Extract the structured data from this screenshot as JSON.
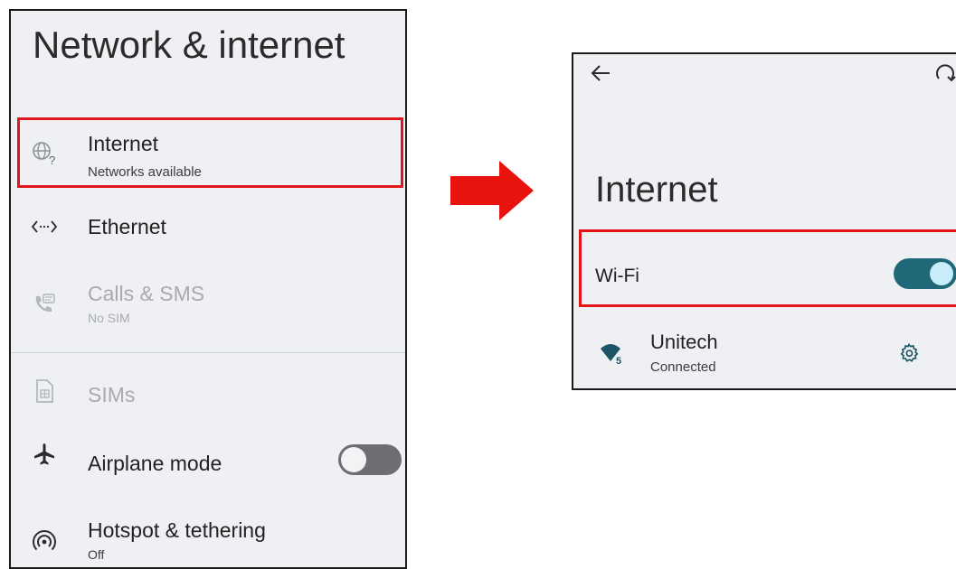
{
  "left": {
    "title": "Network & internet",
    "items": [
      {
        "label": "Internet",
        "sub": "Networks available",
        "icon": "globe-question-icon"
      },
      {
        "label": "Ethernet",
        "icon": "ethernet-icon"
      },
      {
        "label": "Calls & SMS",
        "sub": "No SIM",
        "icon": "calls-sms-icon"
      },
      {
        "label": "SIMs",
        "icon": "sim-card-icon"
      },
      {
        "label": "Airplane mode",
        "icon": "airplane-icon",
        "toggle": "off"
      },
      {
        "label": "Hotspot & tethering",
        "sub": "Off",
        "icon": "hotspot-icon"
      }
    ]
  },
  "right": {
    "title": "Internet",
    "wifi_label": "Wi-Fi",
    "wifi_toggle": "on",
    "network": {
      "name": "Unitech",
      "status": "Connected"
    }
  },
  "colors": {
    "highlight": "#e0161b",
    "toggle_on": "#1f6878",
    "panel_bg": "#eef0f3",
    "arrow": "#e8130f"
  }
}
